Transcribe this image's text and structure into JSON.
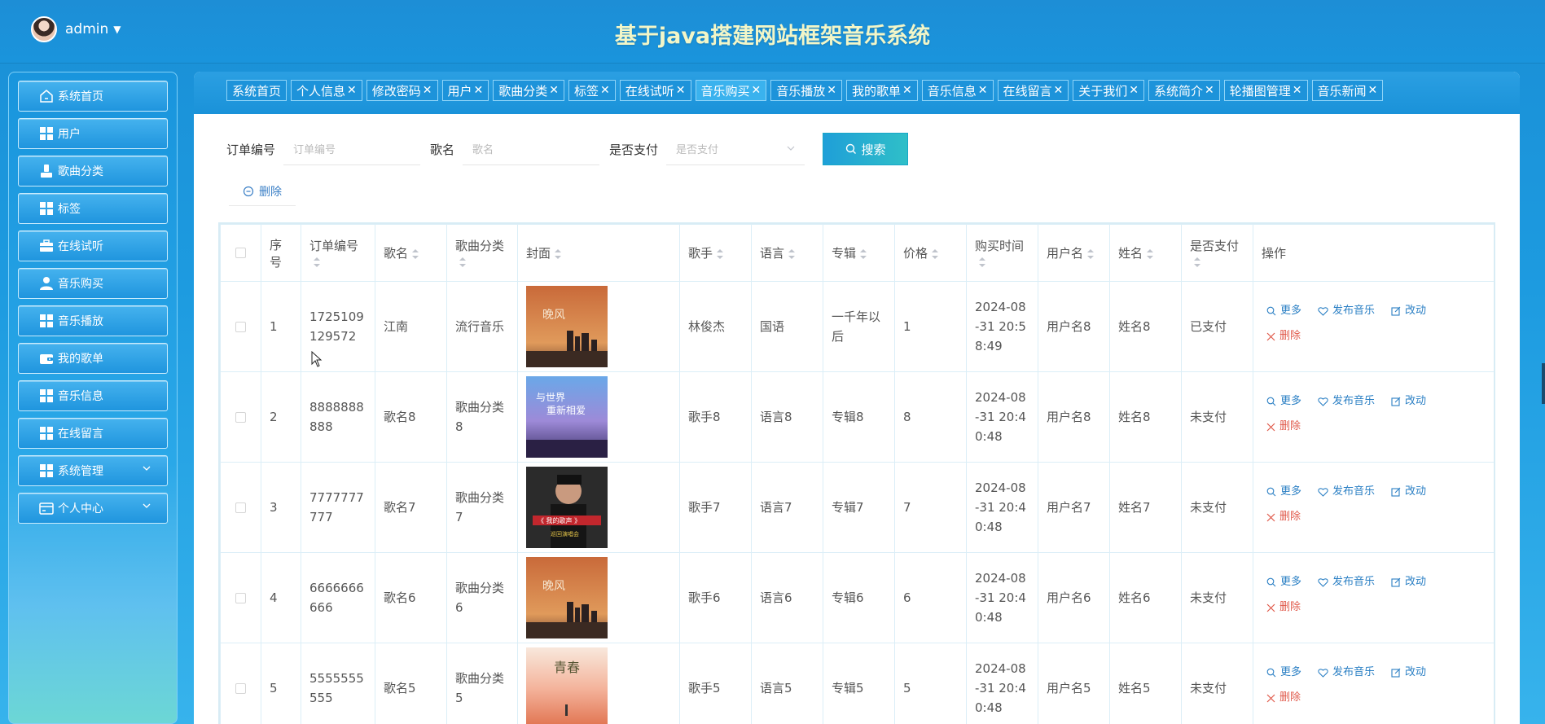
{
  "header": {
    "user": "admin",
    "title": "基于java搭建网站框架音乐系统"
  },
  "sidebar": {
    "items": [
      {
        "label": "系统首页",
        "icon": "home-icon"
      },
      {
        "label": "用户",
        "icon": "grid-icon"
      },
      {
        "label": "歌曲分类",
        "icon": "person-icon"
      },
      {
        "label": "标签",
        "icon": "grid-icon"
      },
      {
        "label": "在线试听",
        "icon": "briefcase-icon"
      },
      {
        "label": "音乐购买",
        "icon": "user-icon"
      },
      {
        "label": "音乐播放",
        "icon": "grid-icon"
      },
      {
        "label": "我的歌单",
        "icon": "wallet-icon"
      },
      {
        "label": "音乐信息",
        "icon": "grid-icon"
      },
      {
        "label": "在线留言",
        "icon": "grid-icon"
      },
      {
        "label": "系统管理",
        "icon": "grid-icon"
      },
      {
        "label": "个人中心",
        "icon": "card-icon"
      }
    ]
  },
  "tabs": [
    {
      "label": "系统首页",
      "closable": false
    },
    {
      "label": "个人信息",
      "closable": true
    },
    {
      "label": "修改密码",
      "closable": true
    },
    {
      "label": "用户",
      "closable": true
    },
    {
      "label": "歌曲分类",
      "closable": true
    },
    {
      "label": "标签",
      "closable": true
    },
    {
      "label": "在线试听",
      "closable": true
    },
    {
      "label": "音乐购买",
      "closable": true,
      "active": true
    },
    {
      "label": "音乐播放",
      "closable": true
    },
    {
      "label": "我的歌单",
      "closable": true
    },
    {
      "label": "音乐信息",
      "closable": true
    },
    {
      "label": "在线留言",
      "closable": true
    },
    {
      "label": "关于我们",
      "closable": true
    },
    {
      "label": "系统简介",
      "closable": true
    },
    {
      "label": "轮播图管理",
      "closable": true
    },
    {
      "label": "音乐新闻",
      "closable": true
    }
  ],
  "search": {
    "order_label": "订单编号",
    "order_placeholder": "订单编号",
    "song_label": "歌名",
    "song_placeholder": "歌名",
    "paid_label": "是否支付",
    "paid_placeholder": "是否支付",
    "button": "搜索",
    "delete_button": "删除"
  },
  "table": {
    "columns": [
      "序号",
      "订单编号",
      "歌名",
      "歌曲分类",
      "封面",
      "歌手",
      "语言",
      "专辑",
      "价格",
      "购买时间",
      "用户名",
      "姓名",
      "是否支付",
      "操作"
    ],
    "actions": {
      "more": "更多",
      "publish": "发布音乐",
      "edit": "改动",
      "delete": "删除"
    },
    "rows": [
      {
        "index": "1",
        "order": "1725109129572",
        "song": "江南",
        "category": "流行音乐",
        "cover": "orange-city",
        "singer": "林俊杰",
        "language": "国语",
        "album": "一千年以后",
        "price": "1",
        "time": "2024-08-31 20:58:49",
        "username": "用户名8",
        "name": "姓名8",
        "paid": "已支付"
      },
      {
        "index": "2",
        "order": "8888888888",
        "song": "歌名8",
        "category": "歌曲分类8",
        "cover": "purple-sky",
        "singer": "歌手8",
        "language": "语言8",
        "album": "专辑8",
        "price": "8",
        "time": "2024-08-31 20:40:48",
        "username": "用户名8",
        "name": "姓名8",
        "paid": "未支付"
      },
      {
        "index": "3",
        "order": "7777777777",
        "song": "歌名7",
        "category": "歌曲分类7",
        "cover": "dark-poster",
        "singer": "歌手7",
        "language": "语言7",
        "album": "专辑7",
        "price": "7",
        "time": "2024-08-31 20:40:48",
        "username": "用户名7",
        "name": "姓名7",
        "paid": "未支付"
      },
      {
        "index": "4",
        "order": "6666666666",
        "song": "歌名6",
        "category": "歌曲分类6",
        "cover": "orange-city",
        "singer": "歌手6",
        "language": "语言6",
        "album": "专辑6",
        "price": "6",
        "time": "2024-08-31 20:40:48",
        "username": "用户名6",
        "name": "姓名6",
        "paid": "未支付"
      },
      {
        "index": "5",
        "order": "5555555555",
        "song": "歌名5",
        "category": "歌曲分类5",
        "cover": "pink-sunset",
        "singer": "歌手5",
        "language": "语言5",
        "album": "专辑5",
        "price": "5",
        "time": "2024-08-31 20:40:48",
        "username": "用户名5",
        "name": "姓名5",
        "paid": "未支付"
      }
    ]
  }
}
